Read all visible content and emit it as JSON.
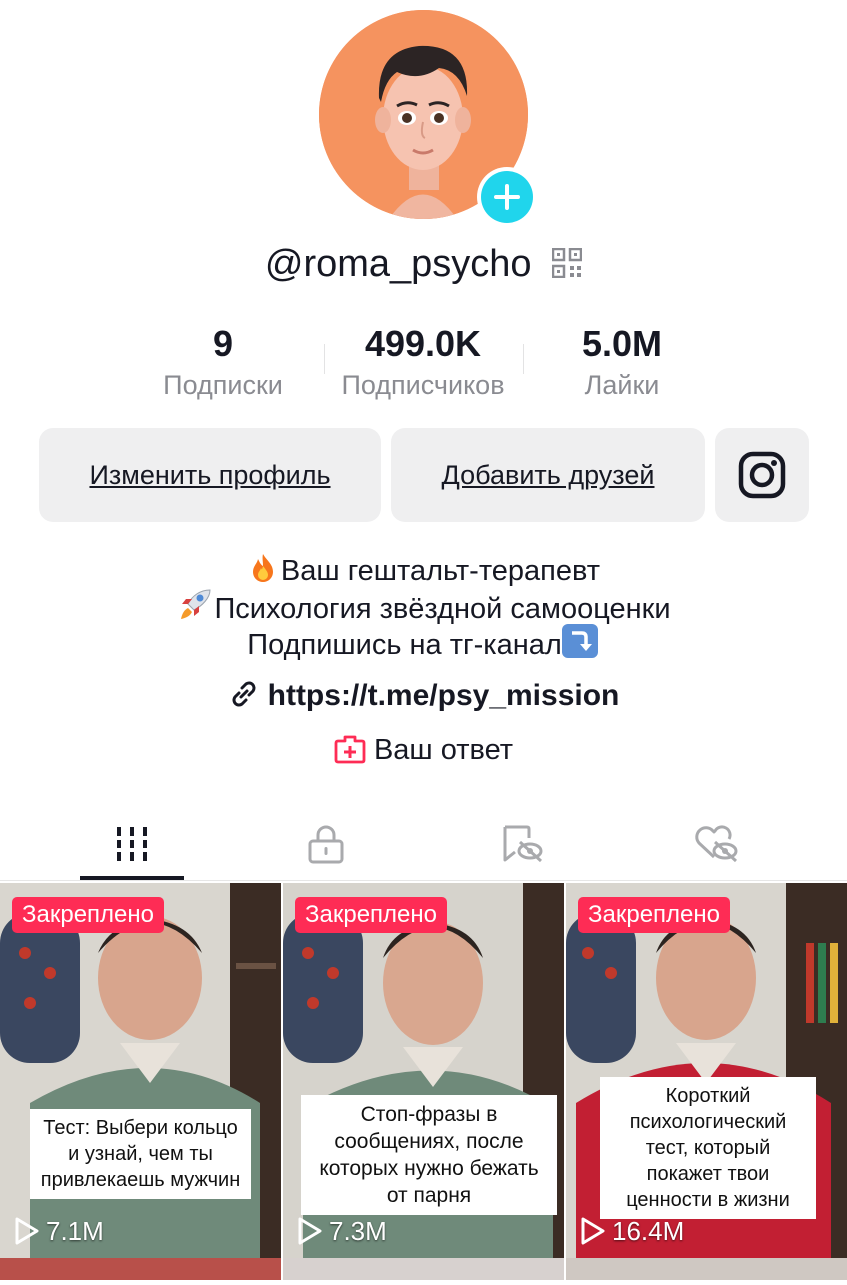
{
  "profile": {
    "username": "@roma_psycho",
    "avatar_color": "#f5935f"
  },
  "stats": [
    {
      "value": "9",
      "label": "Подписки"
    },
    {
      "value": "499.0K",
      "label": "Подписчиков"
    },
    {
      "value": "5.0M",
      "label": "Лайки"
    }
  ],
  "buttons": {
    "edit_profile": "Изменить профиль",
    "add_friends": "Добавить друзей"
  },
  "bio": {
    "line1": "Ваш гештальт-терапевт",
    "line2": "Психология звёздной самооценки",
    "line3": "Подпишись на тг-канал",
    "link": "https://t.me/psy_mission",
    "answer": "Ваш ответ"
  },
  "tabs": [
    "videos-icon",
    "lock-icon",
    "saved-icon",
    "liked-icon"
  ],
  "videos": [
    {
      "pinned": "Закреплено",
      "caption": "Тест: Выбери кольцо и узнай, чем ты привлекаешь мужчин",
      "views": "7.1M"
    },
    {
      "pinned": "Закреплено",
      "caption": "Стоп-фразы в сообщениях, после которых нужно бежать от парня",
      "views": "7.3M"
    },
    {
      "pinned": "Закреплено",
      "caption": "Короткий психологический тест, который покажет твои ценности в жизни",
      "views": "16.4M"
    }
  ],
  "colors": {
    "accent": "#fe2c55",
    "add_button": "#20d5ec",
    "text": "#161823",
    "muted": "#8a8b91"
  }
}
